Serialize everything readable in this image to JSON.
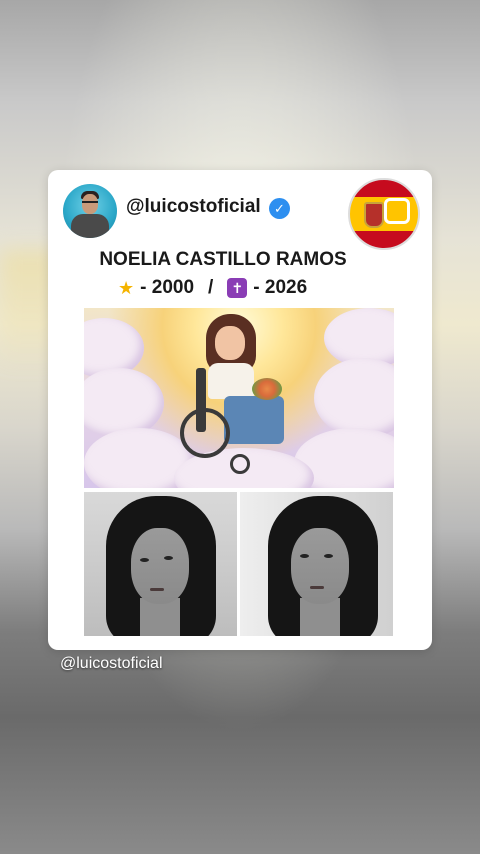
{
  "post": {
    "username": "@luicostoficial",
    "name_title": "NOELIA CASTILLO RAMOS",
    "birth_year": "- 2000",
    "separator": "/",
    "death_year": "- 2026",
    "birth_icon": "star-icon",
    "death_icon": "latin-cross-icon",
    "verified_glyph": "✓",
    "flag": "spain-flag"
  },
  "overlay": {
    "credit_text": "@luicostoficial"
  },
  "colors": {
    "verified": "#2d8ff0",
    "flag_red": "#c60b1e",
    "flag_yellow": "#ffc400",
    "cross_purple": "#8a3db5",
    "star_gold": "#f5b400"
  }
}
